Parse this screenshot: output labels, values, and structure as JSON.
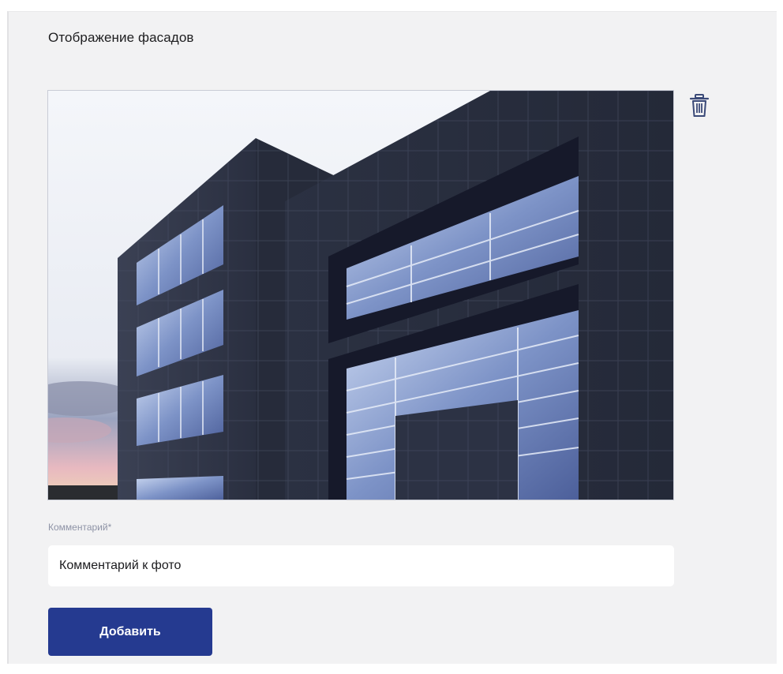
{
  "section": {
    "title": "Отображение фасадов"
  },
  "photo": {
    "subject": "building-facade-photo",
    "delete_icon": "trash-icon"
  },
  "comment": {
    "label": "Комментарий*",
    "value": "Комментарий к фото"
  },
  "actions": {
    "add_label": "Добавить"
  },
  "colors": {
    "panel_bg": "#f2f2f3",
    "button_bg": "#253a90",
    "icon": "#3b4a78",
    "label": "#8e93a6"
  }
}
